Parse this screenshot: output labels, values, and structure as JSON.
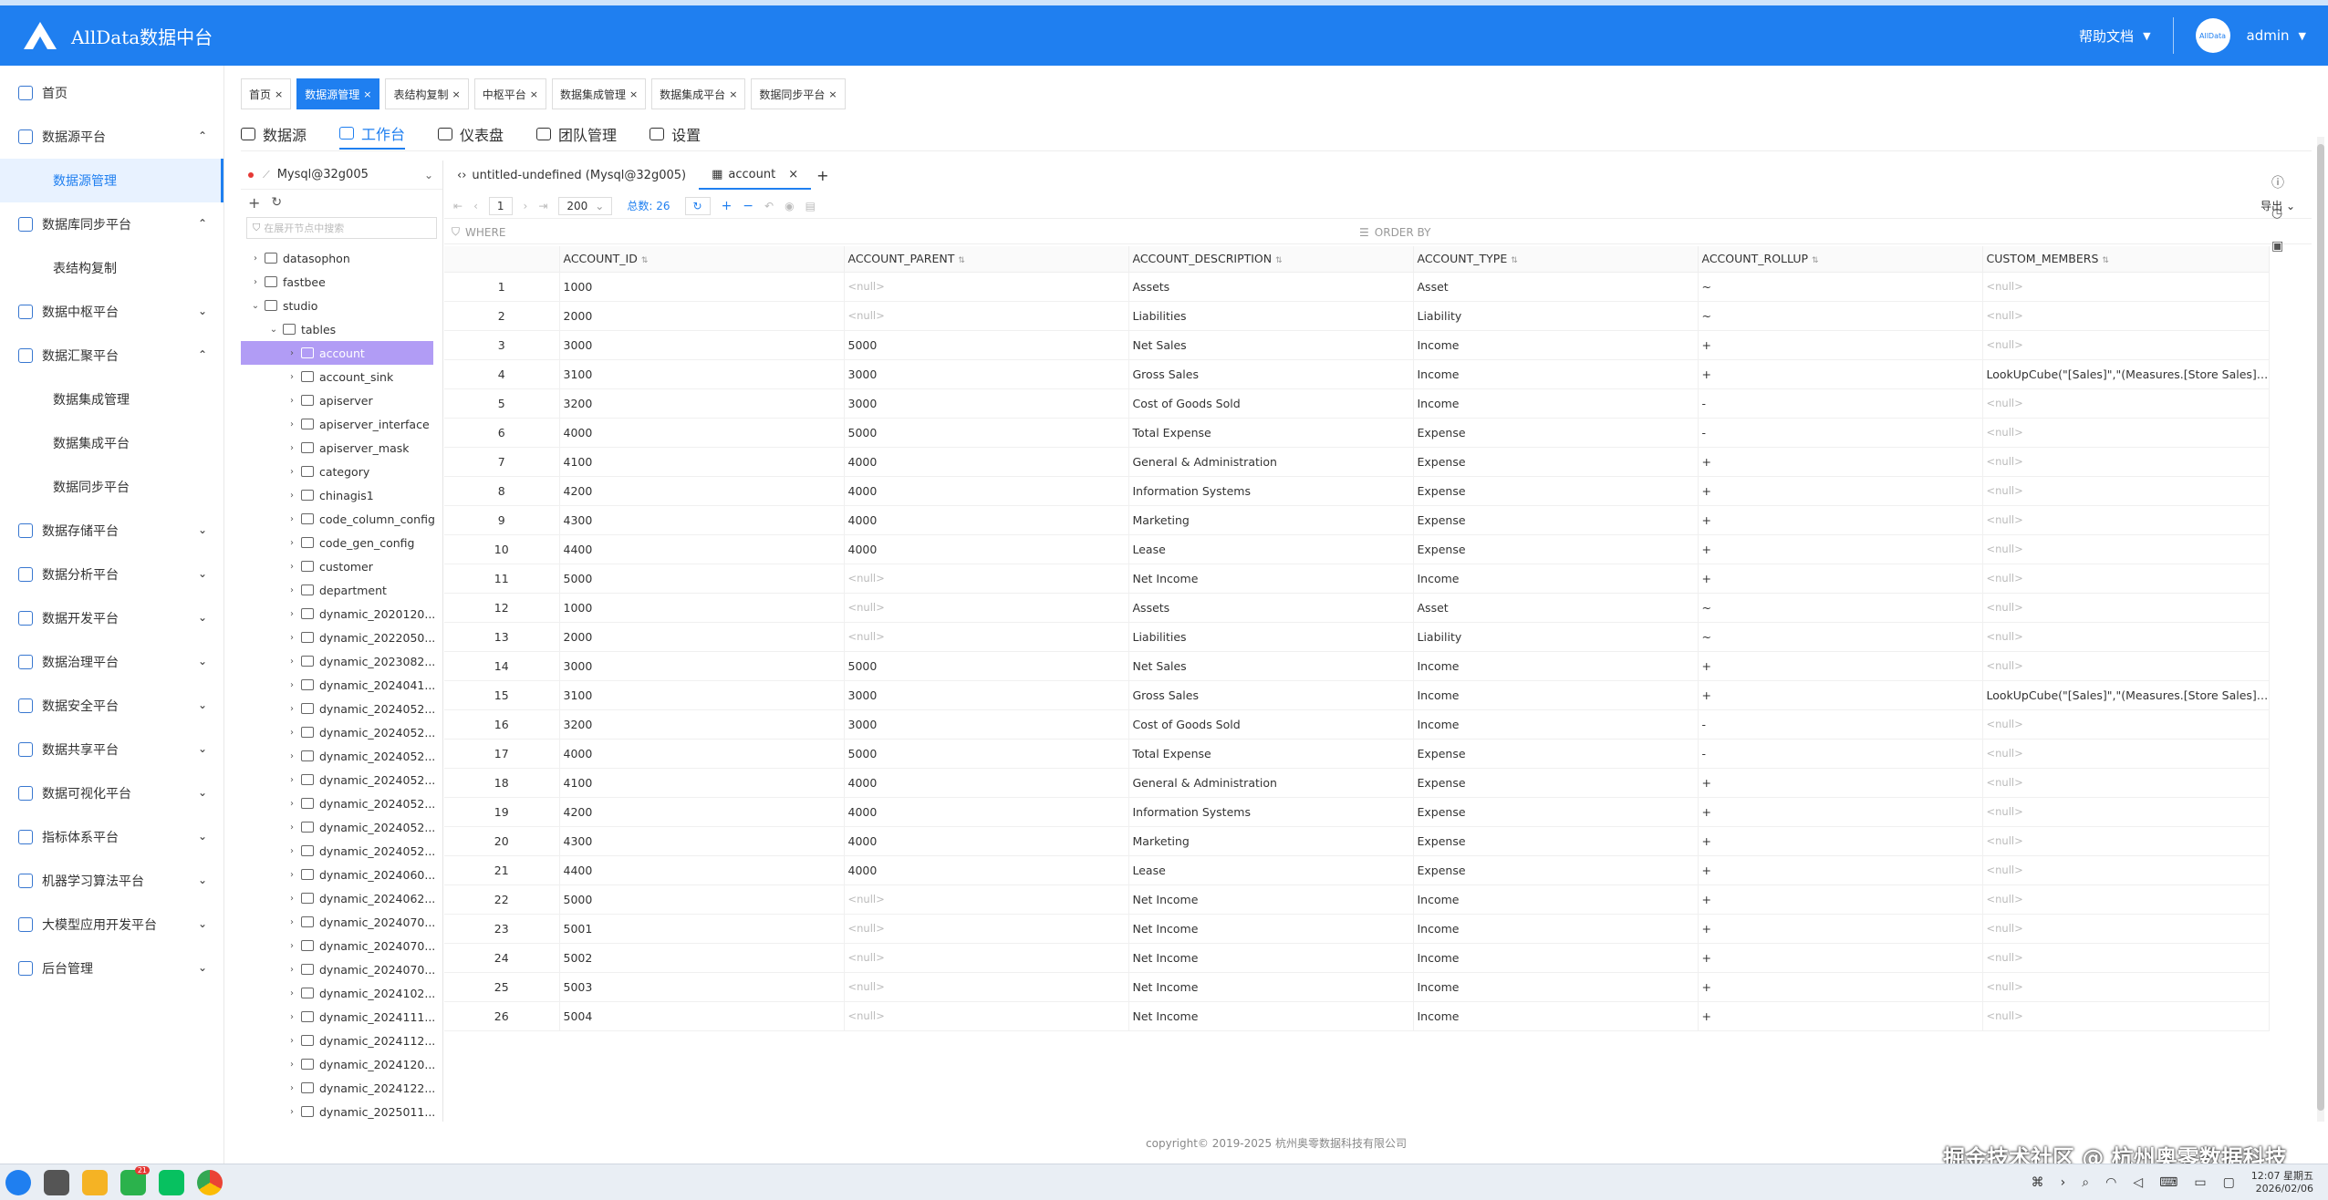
{
  "header": {
    "app_title": "AllData数据中台",
    "help_label": "帮助文档",
    "avatar_text": "AllData",
    "user_name": "admin"
  },
  "sidebar": {
    "items": [
      {
        "label": "首页",
        "type": "item"
      },
      {
        "label": "数据源平台",
        "type": "group",
        "open": true
      },
      {
        "label": "数据源管理",
        "type": "sub",
        "active": true
      },
      {
        "label": "数据库同步平台",
        "type": "group",
        "open": true
      },
      {
        "label": "表结构复制",
        "type": "sub"
      },
      {
        "label": "数据中枢平台",
        "type": "group"
      },
      {
        "label": "数据汇聚平台",
        "type": "group",
        "open": true
      },
      {
        "label": "数据集成管理",
        "type": "sub"
      },
      {
        "label": "数据集成平台",
        "type": "sub"
      },
      {
        "label": "数据同步平台",
        "type": "sub"
      },
      {
        "label": "数据存储平台",
        "type": "group"
      },
      {
        "label": "数据分析平台",
        "type": "group"
      },
      {
        "label": "数据开发平台",
        "type": "group"
      },
      {
        "label": "数据治理平台",
        "type": "group"
      },
      {
        "label": "数据安全平台",
        "type": "group"
      },
      {
        "label": "数据共享平台",
        "type": "group"
      },
      {
        "label": "数据可视化平台",
        "type": "group"
      },
      {
        "label": "指标体系平台",
        "type": "group"
      },
      {
        "label": "机器学习算法平台",
        "type": "group"
      },
      {
        "label": "大模型应用开发平台",
        "type": "group"
      },
      {
        "label": "后台管理",
        "type": "group"
      }
    ]
  },
  "tabs": [
    {
      "label": "首页",
      "active": false
    },
    {
      "label": "数据源管理",
      "active": true
    },
    {
      "label": "表结构复制",
      "active": false
    },
    {
      "label": "中枢平台",
      "active": false
    },
    {
      "label": "数据集成管理",
      "active": false
    },
    {
      "label": "数据集成平台",
      "active": false
    },
    {
      "label": "数据同步平台",
      "active": false
    }
  ],
  "subtabs": [
    {
      "label": "数据源",
      "active": false
    },
    {
      "label": "工作台",
      "active": true
    },
    {
      "label": "仪表盘",
      "active": false
    },
    {
      "label": "团队管理",
      "active": false
    },
    {
      "label": "设置",
      "active": false
    }
  ],
  "tree": {
    "connection": "Mysql@32g005",
    "search_placeholder": "在展开节点中搜索",
    "nodes": [
      {
        "label": "datasophon",
        "level": 0,
        "arrow": "›",
        "kind": "db"
      },
      {
        "label": "fastbee",
        "level": 0,
        "arrow": "›",
        "kind": "db"
      },
      {
        "label": "studio",
        "level": 0,
        "arrow": "⌄",
        "kind": "db"
      },
      {
        "label": "tables",
        "level": 1,
        "arrow": "⌄",
        "kind": "folder"
      },
      {
        "label": "account",
        "level": 2,
        "arrow": "›",
        "kind": "table",
        "selected": true
      },
      {
        "label": "account_sink",
        "level": 2,
        "arrow": "›",
        "kind": "table"
      },
      {
        "label": "apiserver",
        "level": 2,
        "arrow": "›",
        "kind": "table"
      },
      {
        "label": "apiserver_interface",
        "level": 2,
        "arrow": "›",
        "kind": "table"
      },
      {
        "label": "apiserver_mask",
        "level": 2,
        "arrow": "›",
        "kind": "table"
      },
      {
        "label": "category",
        "level": 2,
        "arrow": "›",
        "kind": "table"
      },
      {
        "label": "chinagis1",
        "level": 2,
        "arrow": "›",
        "kind": "table"
      },
      {
        "label": "code_column_config",
        "level": 2,
        "arrow": "›",
        "kind": "table"
      },
      {
        "label": "code_gen_config",
        "level": 2,
        "arrow": "›",
        "kind": "table"
      },
      {
        "label": "customer",
        "level": 2,
        "arrow": "›",
        "kind": "table"
      },
      {
        "label": "department",
        "level": 2,
        "arrow": "›",
        "kind": "table"
      },
      {
        "label": "dynamic_2020120...",
        "level": 2,
        "arrow": "›",
        "kind": "table"
      },
      {
        "label": "dynamic_2022050...",
        "level": 2,
        "arrow": "›",
        "kind": "table"
      },
      {
        "label": "dynamic_2023082...",
        "level": 2,
        "arrow": "›",
        "kind": "table"
      },
      {
        "label": "dynamic_2024041...",
        "level": 2,
        "arrow": "›",
        "kind": "table"
      },
      {
        "label": "dynamic_2024052...",
        "level": 2,
        "arrow": "›",
        "kind": "table"
      },
      {
        "label": "dynamic_2024052...",
        "level": 2,
        "arrow": "›",
        "kind": "table"
      },
      {
        "label": "dynamic_2024052...",
        "level": 2,
        "arrow": "›",
        "kind": "table"
      },
      {
        "label": "dynamic_2024052...",
        "level": 2,
        "arrow": "›",
        "kind": "table"
      },
      {
        "label": "dynamic_2024052...",
        "level": 2,
        "arrow": "›",
        "kind": "table"
      },
      {
        "label": "dynamic_2024052...",
        "level": 2,
        "arrow": "›",
        "kind": "table"
      },
      {
        "label": "dynamic_2024052...",
        "level": 2,
        "arrow": "›",
        "kind": "table"
      },
      {
        "label": "dynamic_2024060...",
        "level": 2,
        "arrow": "›",
        "kind": "table"
      },
      {
        "label": "dynamic_2024062...",
        "level": 2,
        "arrow": "›",
        "kind": "table"
      },
      {
        "label": "dynamic_2024070...",
        "level": 2,
        "arrow": "›",
        "kind": "table"
      },
      {
        "label": "dynamic_2024070...",
        "level": 2,
        "arrow": "›",
        "kind": "table"
      },
      {
        "label": "dynamic_2024070...",
        "level": 2,
        "arrow": "›",
        "kind": "table"
      },
      {
        "label": "dynamic_2024102...",
        "level": 2,
        "arrow": "›",
        "kind": "table"
      },
      {
        "label": "dynamic_2024111...",
        "level": 2,
        "arrow": "›",
        "kind": "table"
      },
      {
        "label": "dynamic_2024112...",
        "level": 2,
        "arrow": "›",
        "kind": "table"
      },
      {
        "label": "dynamic_2024120...",
        "level": 2,
        "arrow": "›",
        "kind": "table"
      },
      {
        "label": "dynamic_2024122...",
        "level": 2,
        "arrow": "›",
        "kind": "table"
      },
      {
        "label": "dynamic_2025011...",
        "level": 2,
        "arrow": "›",
        "kind": "table"
      }
    ]
  },
  "editor": {
    "tabs": [
      {
        "label": "untitled-undefined (Mysql@32g005)",
        "active": false
      },
      {
        "label": "account",
        "active": true
      }
    ],
    "page": "1",
    "page_size": "200",
    "total": "总数: 26",
    "export_label": "导出",
    "where_label": "WHERE",
    "order_label": "ORDER BY"
  },
  "grid": {
    "columns": [
      "ACCOUNT_ID",
      "ACCOUNT_PARENT",
      "ACCOUNT_DESCRIPTION",
      "ACCOUNT_TYPE",
      "ACCOUNT_ROLLUP",
      "CUSTOM_MEMBERS"
    ],
    "rows": [
      [
        "1",
        "1000",
        "<null>",
        "Assets",
        "Asset",
        "~",
        "<null>"
      ],
      [
        "2",
        "2000",
        "<null>",
        "Liabilities",
        "Liability",
        "~",
        "<null>"
      ],
      [
        "3",
        "3000",
        "5000",
        "Net Sales",
        "Income",
        "+",
        "<null>"
      ],
      [
        "4",
        "3100",
        "3000",
        "Gross Sales",
        "Income",
        "+",
        "LookUpCube(\"[Sales]\",\"(Measures.[Store Sales],\"+time..."
      ],
      [
        "5",
        "3200",
        "3000",
        "Cost of Goods Sold",
        "Income",
        "-",
        "<null>"
      ],
      [
        "6",
        "4000",
        "5000",
        "Total Expense",
        "Expense",
        "-",
        "<null>"
      ],
      [
        "7",
        "4100",
        "4000",
        "General & Administration",
        "Expense",
        "+",
        "<null>"
      ],
      [
        "8",
        "4200",
        "4000",
        "Information Systems",
        "Expense",
        "+",
        "<null>"
      ],
      [
        "9",
        "4300",
        "4000",
        "Marketing",
        "Expense",
        "+",
        "<null>"
      ],
      [
        "10",
        "4400",
        "4000",
        "Lease",
        "Expense",
        "+",
        "<null>"
      ],
      [
        "11",
        "5000",
        "<null>",
        "Net Income",
        "Income",
        "+",
        "<null>"
      ],
      [
        "12",
        "1000",
        "<null>",
        "Assets",
        "Asset",
        "~",
        "<null>"
      ],
      [
        "13",
        "2000",
        "<null>",
        "Liabilities",
        "Liability",
        "~",
        "<null>"
      ],
      [
        "14",
        "3000",
        "5000",
        "Net Sales",
        "Income",
        "+",
        "<null>"
      ],
      [
        "15",
        "3100",
        "3000",
        "Gross Sales",
        "Income",
        "+",
        "LookUpCube(\"[Sales]\",\"(Measures.[Store Sales],\"+time..."
      ],
      [
        "16",
        "3200",
        "3000",
        "Cost of Goods Sold",
        "Income",
        "-",
        "<null>"
      ],
      [
        "17",
        "4000",
        "5000",
        "Total Expense",
        "Expense",
        "-",
        "<null>"
      ],
      [
        "18",
        "4100",
        "4000",
        "General & Administration",
        "Expense",
        "+",
        "<null>"
      ],
      [
        "19",
        "4200",
        "4000",
        "Information Systems",
        "Expense",
        "+",
        "<null>"
      ],
      [
        "20",
        "4300",
        "4000",
        "Marketing",
        "Expense",
        "+",
        "<null>"
      ],
      [
        "21",
        "4400",
        "4000",
        "Lease",
        "Expense",
        "+",
        "<null>"
      ],
      [
        "22",
        "5000",
        "<null>",
        "Net Income",
        "Income",
        "+",
        "<null>"
      ],
      [
        "23",
        "5001",
        "<null>",
        "Net Income",
        "Income",
        "+",
        "<null>"
      ],
      [
        "24",
        "5002",
        "<null>",
        "Net Income",
        "Income",
        "+",
        "<null>"
      ],
      [
        "25",
        "5003",
        "<null>",
        "Net Income",
        "Income",
        "+",
        "<null>"
      ],
      [
        "26",
        "5004",
        "<null>",
        "Net Income",
        "Income",
        "+",
        "<null>"
      ]
    ]
  },
  "footer": {
    "text": "copyright© 2019-2025 杭州奥零数据科技有限公司"
  },
  "taskbar": {
    "badge_count": "21",
    "time": "12:07 星期五",
    "date": "2026/02/06",
    "watermark": "掘金技术社区 @ 杭州奥零数据科技"
  },
  "colors": {
    "primary": "#1f7ff0",
    "selected_tree": "#b19cf5",
    "null_text": "#bbbbbb"
  }
}
